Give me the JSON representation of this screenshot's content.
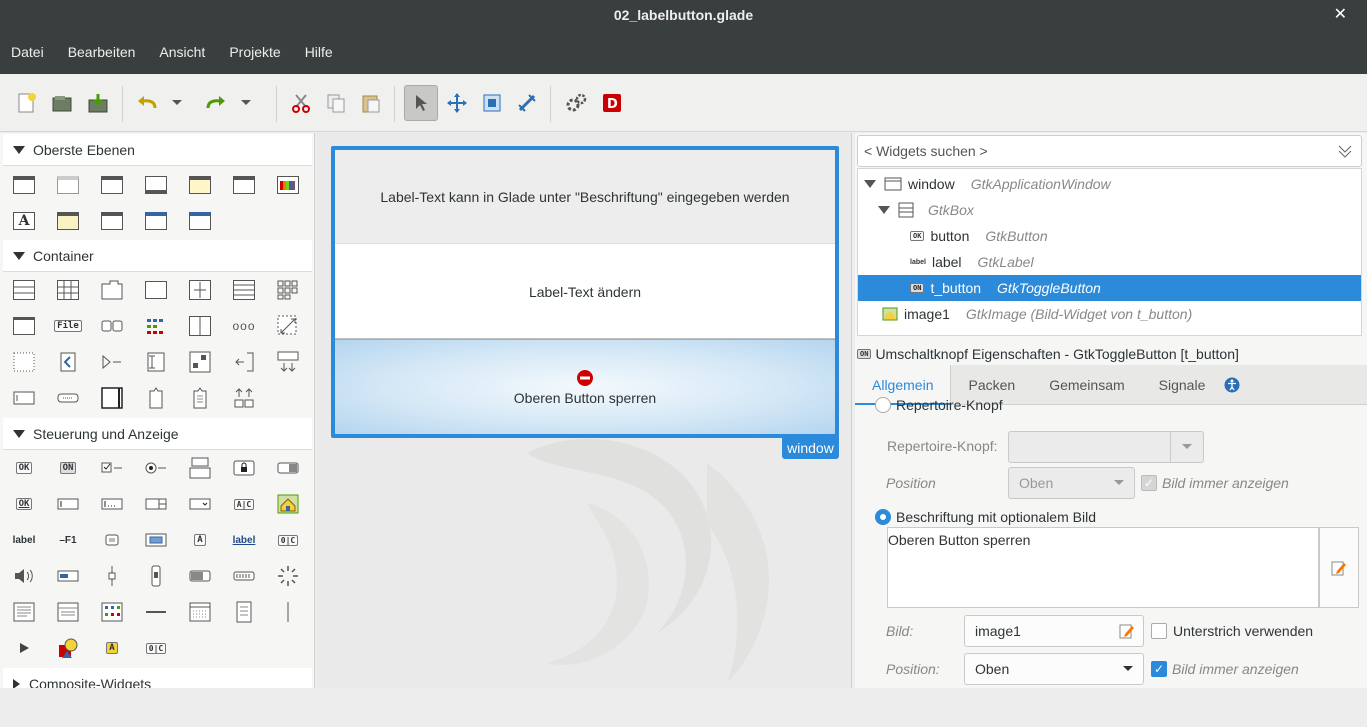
{
  "window_title": "02_labelbutton.glade",
  "close_glyph": "✕",
  "menu": [
    "Datei",
    "Bearbeiten",
    "Ansicht",
    "Projekte",
    "Hilfe"
  ],
  "palette": {
    "sections": [
      "Oberste Ebenen",
      "Container",
      "Steuerung und Anzeige",
      "Composite-Widgets"
    ],
    "icon_texts": {
      "file": "File",
      "ok": "OK",
      "on": "ON",
      "label": "label",
      "f1": "–F1",
      "a": "A",
      "ac": "A|C",
      "dots": "ooo",
      "ac2": "0|C"
    }
  },
  "design": {
    "label_text": "Label-Text kann in Glade unter \"Beschriftung\" eingegeben werden",
    "button_text": "Label-Text ändern",
    "toggle_text": "Oberen Button sperren",
    "window_tag": "window"
  },
  "inspector": {
    "search_placeholder": "< Widgets suchen >",
    "tree": [
      {
        "name": "window",
        "type": "GtkApplicationWindow"
      },
      {
        "name": "",
        "type": "GtkBox"
      },
      {
        "name": "button",
        "type": "GtkButton"
      },
      {
        "name": "label",
        "type": "GtkLabel"
      },
      {
        "name": "t_button",
        "type": "GtkToggleButton"
      },
      {
        "name": "image1",
        "type": "GtkImage  (Bild-Widget von t_button)"
      }
    ],
    "props_title": "Umschaltknopf Eigenschaften - GtkToggleButton [t_button]",
    "tabs": [
      "Allgemein",
      "Packen",
      "Gemeinsam",
      "Signale"
    ],
    "repertoire_radio": "Repertoire-Knopf",
    "repertoire_label": "Repertoire-Knopf:",
    "position_label": "Position",
    "position_value_disabled": "Oben",
    "always_show_image": "Bild immer anzeigen",
    "label_radio": "Beschriftung mit optionalem Bild",
    "label_text_value": "Oberen Button sperren",
    "image_label": "Bild:",
    "image_value": "image1",
    "underline_label": "Unterstrich verwenden",
    "position_label2": "Position:",
    "position_value": "Oben",
    "always_show_image2": "Bild immer anzeigen"
  }
}
